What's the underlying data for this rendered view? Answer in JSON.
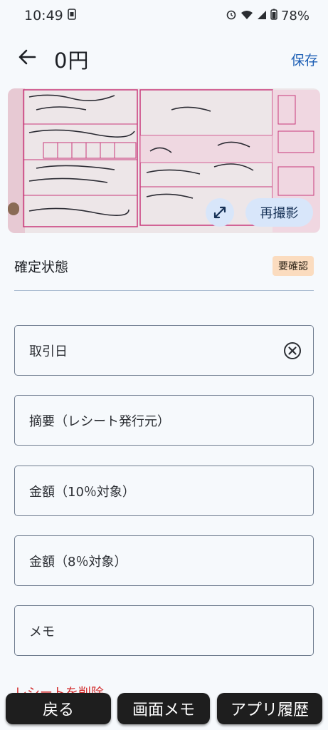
{
  "status_bar": {
    "time": "10:49",
    "battery": "78%"
  },
  "app_bar": {
    "title": "0円",
    "save_label": "保存"
  },
  "receipt": {
    "retake_label": "再撮影"
  },
  "confirm_status": {
    "label": "確定状態",
    "badge": "要確認"
  },
  "fields": {
    "transaction_date": "取引日",
    "description": "摘要（レシート発行元）",
    "amount_10": "金額（10％対象）",
    "amount_8": "金額（8％対象）",
    "memo": "メモ"
  },
  "delete_label": "レシートを削除",
  "bottom_nav": {
    "back": "戻る",
    "screen_memo": "画面メモ",
    "app_history": "アプリ履歴"
  },
  "colors": {
    "accent": "#1d5fb5",
    "badge_bg": "#fbdcbf",
    "delete": "#d22a2a",
    "chip_bg": "#d8e6fa"
  }
}
